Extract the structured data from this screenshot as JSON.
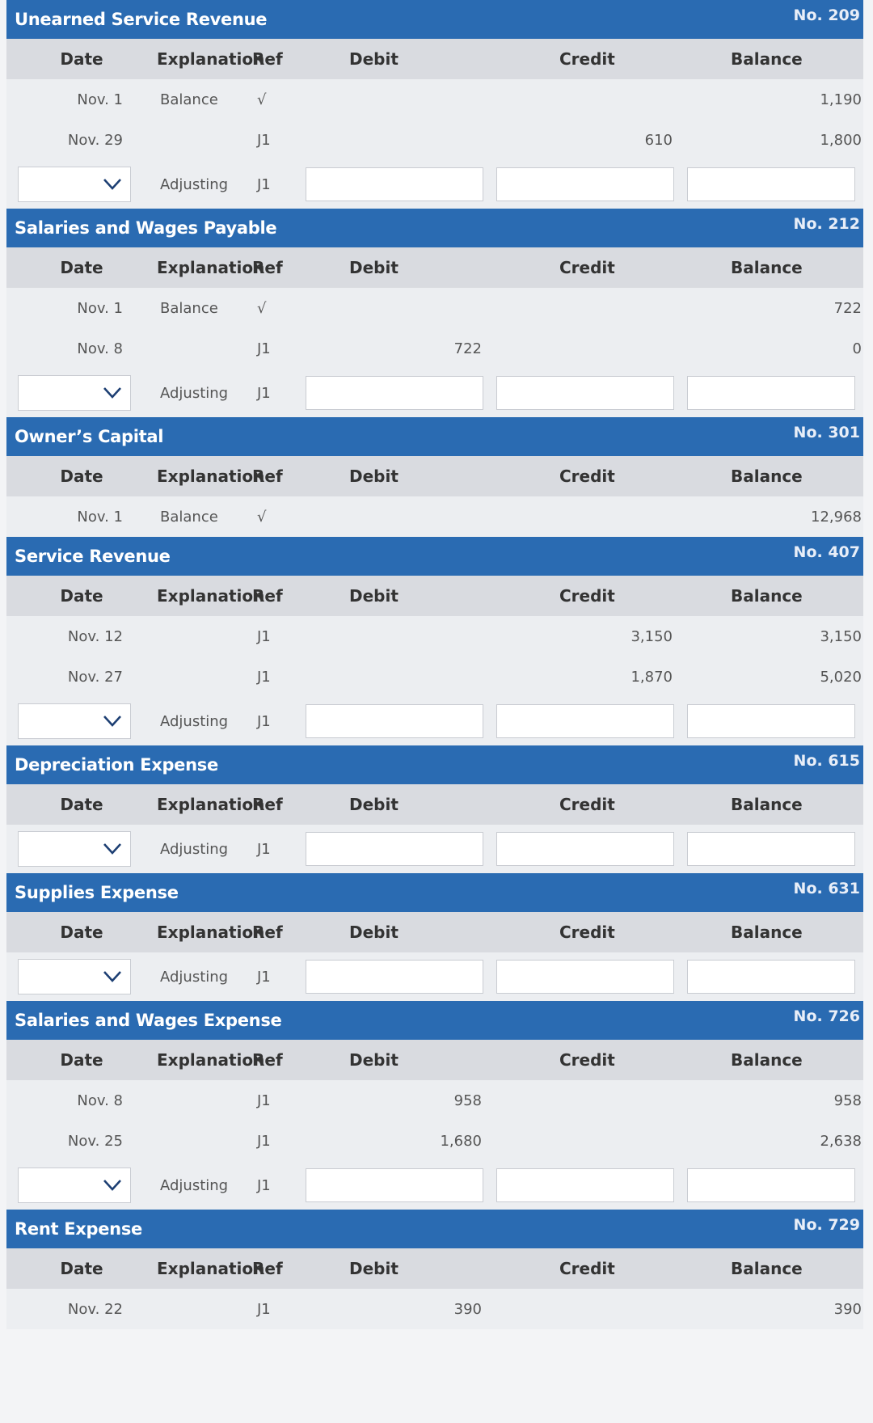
{
  "columns": {
    "date": "Date",
    "explanation": "Explanation",
    "ref": "Ref",
    "debit": "Debit",
    "credit": "Credit",
    "balance": "Balance"
  },
  "accounts": [
    {
      "title": "Unearned Service Revenue",
      "no": "No. 209",
      "rows": [
        {
          "date": "Nov. 1",
          "exp": "Balance",
          "ref": "√",
          "debit": "",
          "credit": "",
          "bal": "1,190"
        },
        {
          "date": "Nov. 29",
          "exp": "",
          "ref": "J1",
          "debit": "",
          "credit": "610",
          "bal": "1,800"
        }
      ],
      "adjusting": {
        "exp": "Adjusting",
        "ref": "J1"
      }
    },
    {
      "title": "Salaries and Wages Payable",
      "no": "No. 212",
      "rows": [
        {
          "date": "Nov. 1",
          "exp": "Balance",
          "ref": "√",
          "debit": "",
          "credit": "",
          "bal": "722"
        },
        {
          "date": "Nov. 8",
          "exp": "",
          "ref": "J1",
          "debit": "722",
          "credit": "",
          "bal": "0"
        }
      ],
      "adjusting": {
        "exp": "Adjusting",
        "ref": "J1"
      }
    },
    {
      "title": "Owner’s Capital",
      "no": "No. 301",
      "rows": [
        {
          "date": "Nov. 1",
          "exp": "Balance",
          "ref": "√",
          "debit": "",
          "credit": "",
          "bal": "12,968"
        }
      ],
      "adjusting": null
    },
    {
      "title": "Service Revenue",
      "no": "No. 407",
      "rows": [
        {
          "date": "Nov. 12",
          "exp": "",
          "ref": "J1",
          "debit": "",
          "credit": "3,150",
          "bal": "3,150"
        },
        {
          "date": "Nov. 27",
          "exp": "",
          "ref": "J1",
          "debit": "",
          "credit": "1,870",
          "bal": "5,020"
        }
      ],
      "adjusting": {
        "exp": "Adjusting",
        "ref": "J1"
      }
    },
    {
      "title": "Depreciation Expense",
      "no": "No. 615",
      "rows": [],
      "adjusting": {
        "exp": "Adjusting",
        "ref": "J1"
      }
    },
    {
      "title": "Supplies Expense",
      "no": "No. 631",
      "rows": [],
      "adjusting": {
        "exp": "Adjusting",
        "ref": "J1"
      }
    },
    {
      "title": "Salaries and Wages Expense",
      "no": "No. 726",
      "rows": [
        {
          "date": "Nov. 8",
          "exp": "",
          "ref": "J1",
          "debit": "958",
          "credit": "",
          "bal": "958"
        },
        {
          "date": "Nov. 25",
          "exp": "",
          "ref": "J1",
          "debit": "1,680",
          "credit": "",
          "bal": "2,638"
        }
      ],
      "adjusting": {
        "exp": "Adjusting",
        "ref": "J1"
      }
    },
    {
      "title": "Rent Expense",
      "no": "No. 729",
      "rows": [
        {
          "date": "Nov. 22",
          "exp": "",
          "ref": "J1",
          "debit": "390",
          "credit": "",
          "bal": "390"
        }
      ],
      "adjusting": null
    }
  ]
}
